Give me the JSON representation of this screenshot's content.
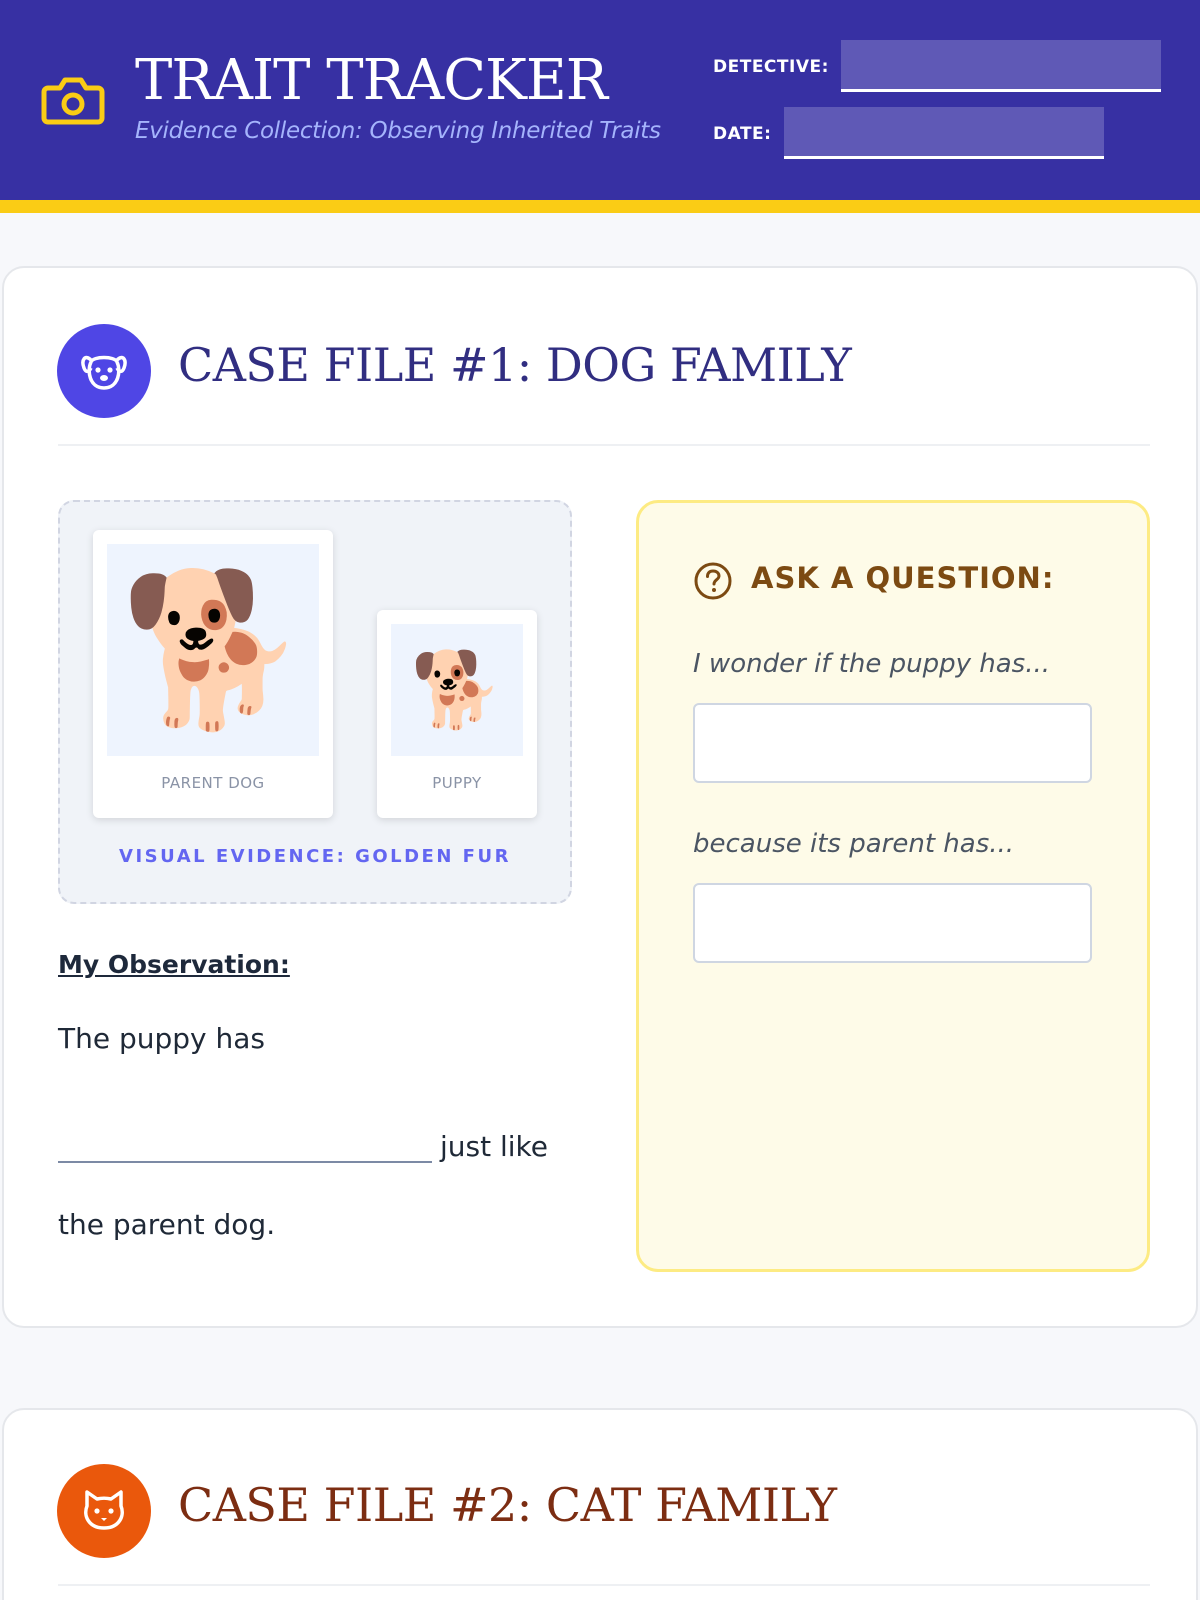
{
  "header": {
    "title": "TRAIT TRACKER",
    "subtitle": "Evidence Collection: Observing Inherited Traits",
    "detective_label": "DETECTIVE:",
    "detective_value": "",
    "date_label": "DATE:",
    "date_value": "",
    "logo_icon": "camera-icon",
    "accent_color": "#facc15",
    "brand_color": "#3730a3"
  },
  "case1": {
    "title": "CASE FILE #1: DOG FAMILY",
    "icon": "dog-face-icon",
    "icon_color": "#4f46e5",
    "title_color": "#312e81",
    "evidence": {
      "parent_label": "PARENT DOG",
      "child_label": "PUPPY",
      "parent_emoji": "🐕",
      "child_emoji": "🐕",
      "caption": "VISUAL EVIDENCE: GOLDEN FUR"
    },
    "observation": {
      "heading": "My Observation:",
      "line1": "The puppy has",
      "line2_suffix": "just like",
      "line3": "the parent dog."
    },
    "question": {
      "icon": "question-circle-icon",
      "title": "ASK A QUESTION:",
      "prompt1": "I wonder if the puppy has...",
      "answer1": "",
      "prompt2": "because its parent has...",
      "answer2": ""
    }
  },
  "case2": {
    "title": "CASE FILE #2: CAT FAMILY",
    "icon": "cat-face-icon",
    "icon_color": "#ea580c",
    "title_color": "#7c2d12"
  }
}
